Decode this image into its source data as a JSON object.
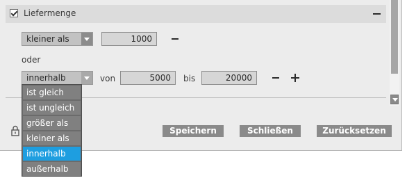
{
  "header": {
    "title": "Liefermenge",
    "checked": true
  },
  "row1": {
    "operator": "kleiner als",
    "value": "1000"
  },
  "or_label": "oder",
  "row2": {
    "operator": "innerhalb",
    "from_label": "von",
    "from_value": "5000",
    "to_label": "bis",
    "to_value": "20000"
  },
  "dropdown": {
    "options": [
      "ist gleich",
      "ist ungleich",
      "größer als",
      "kleiner als",
      "innerhalb",
      "außerhalb"
    ],
    "selected": "innerhalb"
  },
  "buttons": {
    "save": "Speichern",
    "close": "Schließen",
    "reset": "Zurücksetzen"
  },
  "colors": {
    "accent": "#1e9ee0",
    "button_bg": "#8a8a8a",
    "panel_bg": "#ececec"
  }
}
